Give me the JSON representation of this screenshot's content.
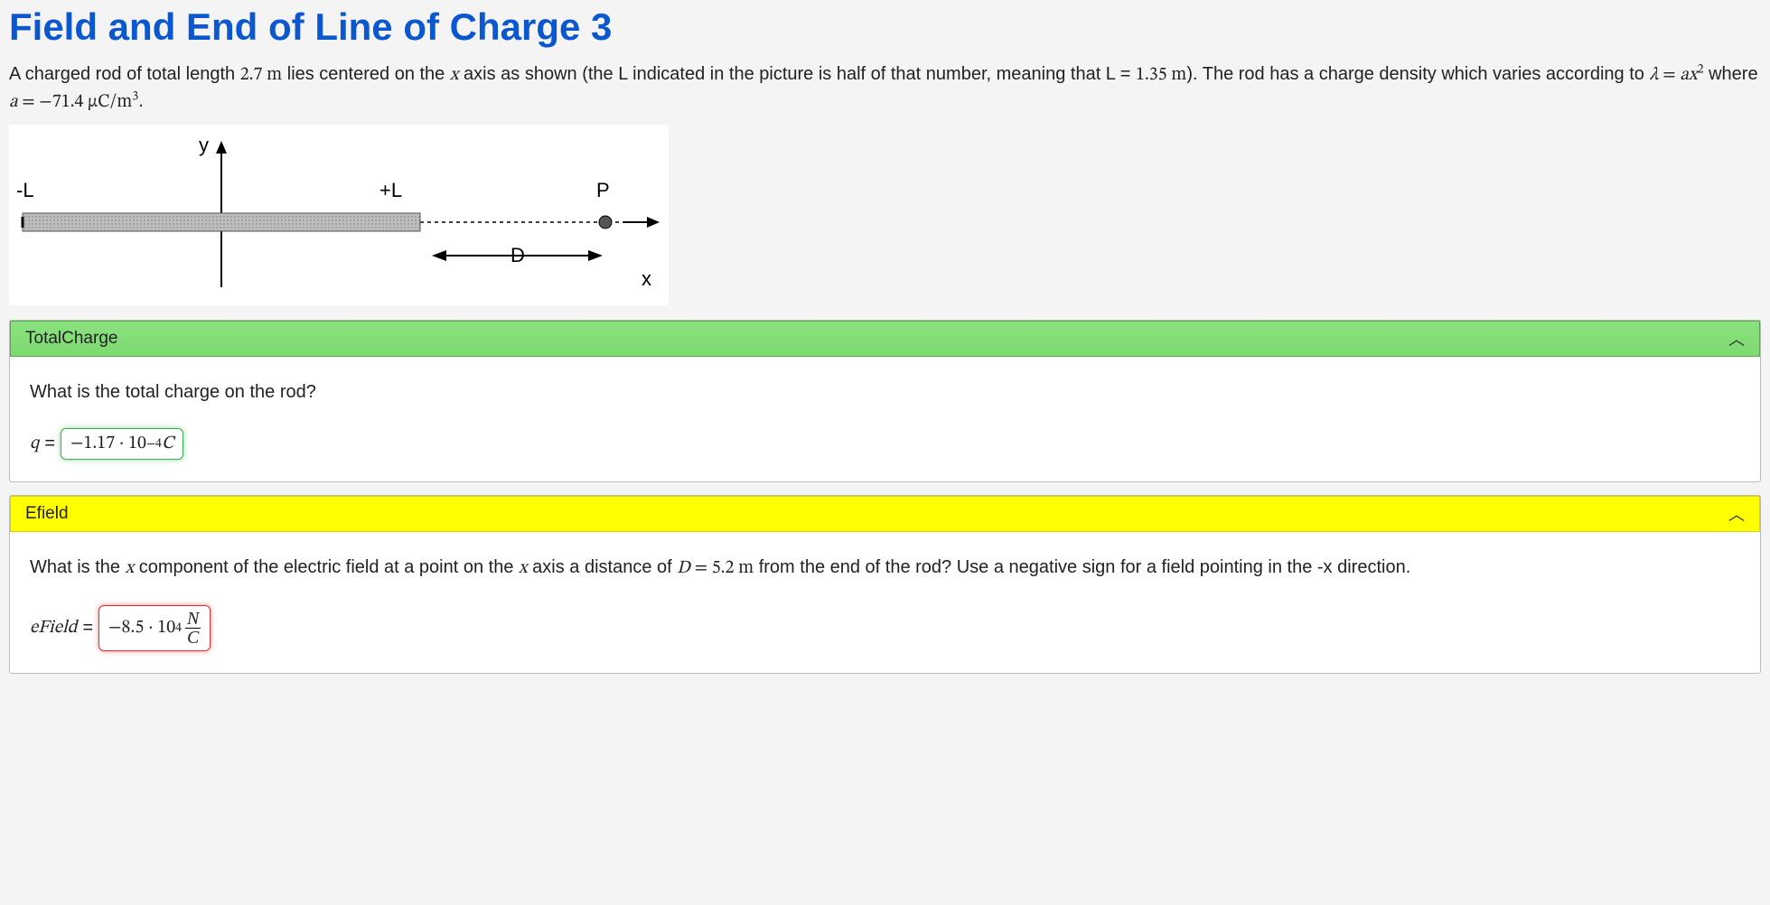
{
  "title": "Field and End of Line of Charge 3",
  "problem": {
    "pre_length": "A charged rod of total length ",
    "total_length": "2.7 m",
    "post_length_pre_axis": " lies centered on the ",
    "axis_var": "x",
    "post_axis": " axis as shown (the L indicated in the picture is half of that number, meaning that L = ",
    "half_length": "1.35 m",
    "post_half": "). The rod has a charge density which varies according to ",
    "lambda": "λ",
    "eq1": " = ",
    "a_var": "a",
    "x_var": "x",
    "exp2": "2",
    "where": " where ",
    "eq2": " = ",
    "a_value": "−71.4 μC/m",
    "exp3": "3",
    "period": "."
  },
  "diagram": {
    "y_label": "y",
    "minus_L": "-L",
    "plus_L": "+L",
    "P": "P",
    "D": "D",
    "x_label": "x"
  },
  "sections": {
    "totalCharge": {
      "header": "TotalCharge",
      "question": "What is the total charge on the rod?",
      "var": "q",
      "eq": " = ",
      "value_mantissa": "−1.17 · 10",
      "value_exp": "−4",
      "unit": " C"
    },
    "efield": {
      "header": "Efield",
      "q_pre": "What is the ",
      "q_var1": "x",
      "q_mid1": " component of the electric field at a point on the ",
      "q_var2": "x",
      "q_mid2": " axis a distance of ",
      "D_var": "D",
      "D_eq": " = ",
      "D_val": "5.2 m",
      "q_post": " from the end of the rod? Use a negative sign for a field pointing in the -x direction.",
      "var": "eField",
      "eq": " = ",
      "value_mantissa": "−8.5 · 10",
      "value_exp": "4",
      "unit_num": "N",
      "unit_den": "C"
    }
  }
}
